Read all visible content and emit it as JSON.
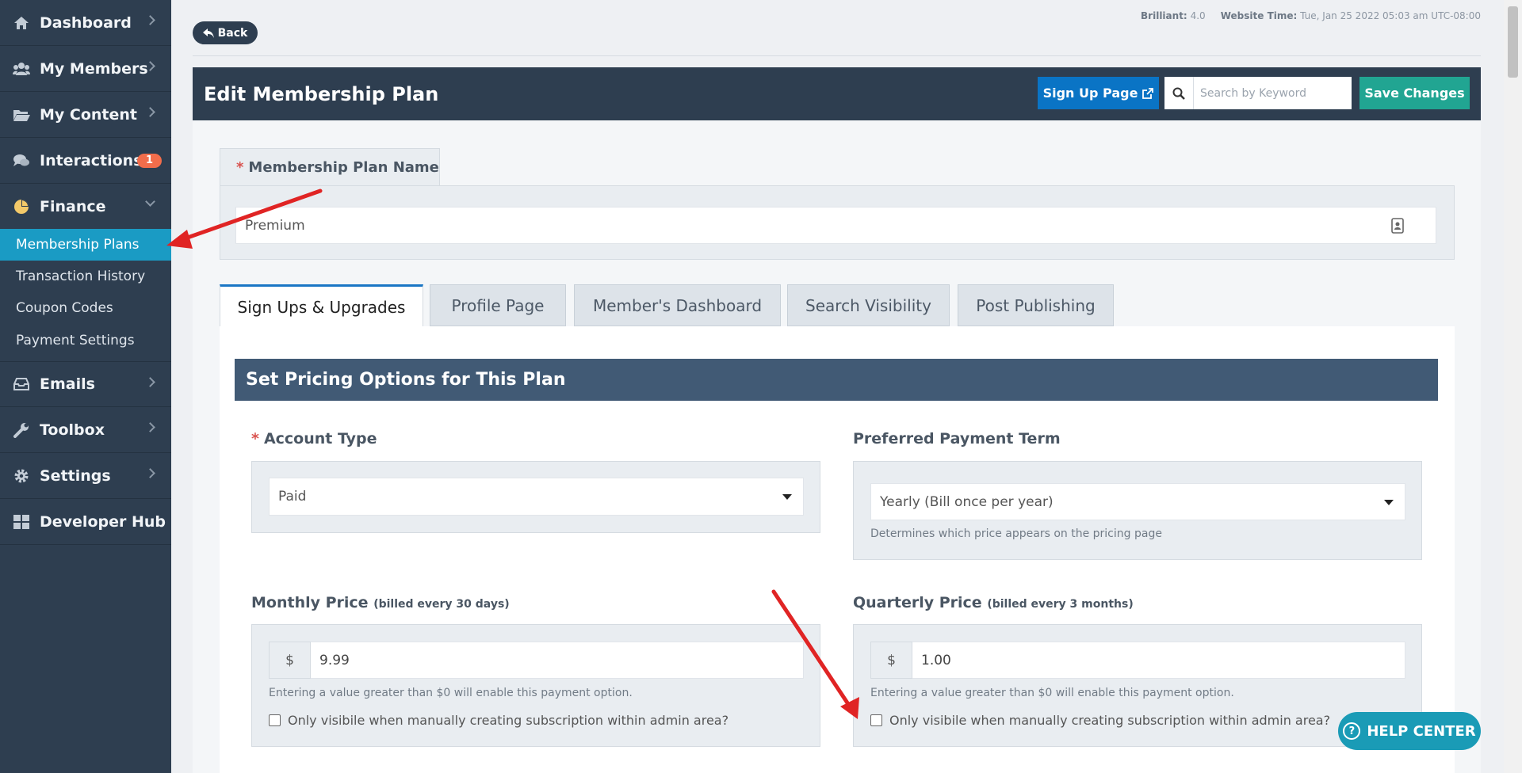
{
  "sidebar": {
    "items": [
      {
        "label": "Dashboard",
        "icon": "dashboard-icon"
      },
      {
        "label": "My Members",
        "icon": "users-icon"
      },
      {
        "label": "My Content",
        "icon": "folder-icon"
      },
      {
        "label": "Interactions",
        "icon": "comments-icon",
        "badge": "1"
      },
      {
        "label": "Finance",
        "icon": "pie-chart-icon"
      },
      {
        "label": "Emails",
        "icon": "inbox-icon"
      },
      {
        "label": "Toolbox",
        "icon": "wrench-icon"
      },
      {
        "label": "Settings",
        "icon": "gear-icon"
      },
      {
        "label": "Developer Hub",
        "icon": "grid-icon"
      }
    ],
    "finance_sub": [
      "Membership Plans",
      "Transaction History",
      "Coupon Codes",
      "Payment Settings"
    ]
  },
  "topinfo": {
    "version_label": "Brilliant:",
    "version_value": "4.0",
    "time_label": "Website Time:",
    "time_value": "Tue, Jan 25 2022 05:03 am UTC-08:00"
  },
  "back_label": "Back",
  "header": {
    "title": "Edit Membership Plan",
    "signup_label": "Sign Up Page",
    "search_placeholder": "Search by Keyword",
    "save_label": "Save Changes"
  },
  "plan_name": {
    "label": "Membership Plan Name",
    "value": "Premium"
  },
  "tabs": [
    "Sign Ups & Upgrades",
    "Profile Page",
    "Member's Dashboard",
    "Search Visibility",
    "Post Publishing"
  ],
  "section_title": "Set Pricing Options for This Plan",
  "account_type": {
    "label": "Account Type",
    "value": "Paid"
  },
  "payment_term": {
    "label": "Preferred Payment Term",
    "value": "Yearly (Bill once per year)",
    "help": "Determines which price appears on the pricing page"
  },
  "monthly": {
    "label": "Monthly Price",
    "sub": "(billed every 30 days)",
    "currency": "$",
    "value": "9.99",
    "help": "Entering a value greater than $0 will enable this payment option.",
    "checkbox": "Only visibile when manually creating subscription within admin area?"
  },
  "quarterly": {
    "label": "Quarterly Price",
    "sub": "(billed every 3 months)",
    "currency": "$",
    "value": "1.00",
    "help": "Entering a value greater than $0 will enable this payment option.",
    "checkbox": "Only visibile when manually creating subscription within admin area?"
  },
  "help_center_label": "HELP CENTER",
  "colors": {
    "sidebar": "#2e3e50",
    "accent": "#1a9bc4",
    "save": "#21a592",
    "annotation_arrow": "#e02424"
  }
}
